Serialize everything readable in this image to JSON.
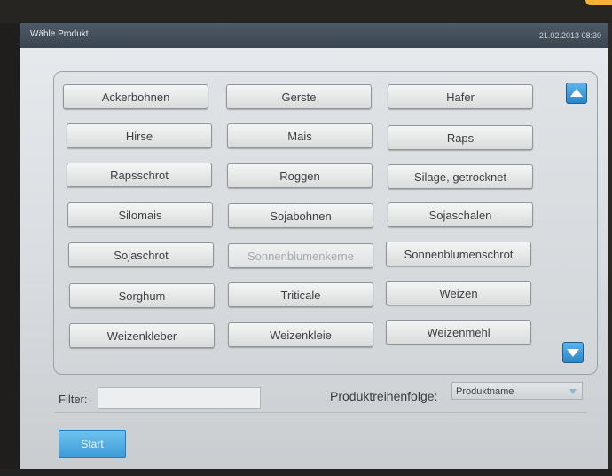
{
  "window": {
    "title": "Wähle Produkt",
    "datetime": "21.02.2013 08:30"
  },
  "products": [
    "Ackerbohnen",
    "Gerste",
    "Hafer",
    "Hirse",
    "Mais",
    "Raps",
    "Rapsschrot",
    "Roggen",
    "Silage, getrocknet",
    "Silomais",
    "Sojabohnen",
    "Sojaschalen",
    "Sojaschrot",
    "Sonnenblumenkerne",
    "Sonnenblumenschrot",
    "Sorghum",
    "Triticale",
    "Weizen",
    "Weizenkleber",
    "Weizenkleie",
    "Weizenmehl"
  ],
  "scroll": {
    "up_icon": "arrow-up-icon",
    "down_icon": "arrow-down-icon",
    "color": "#2a86c8"
  },
  "filter": {
    "label": "Filter:",
    "value": ""
  },
  "order": {
    "label": "Produktreihenfolge:",
    "value": "Produktname"
  },
  "start": {
    "label": "Start"
  }
}
